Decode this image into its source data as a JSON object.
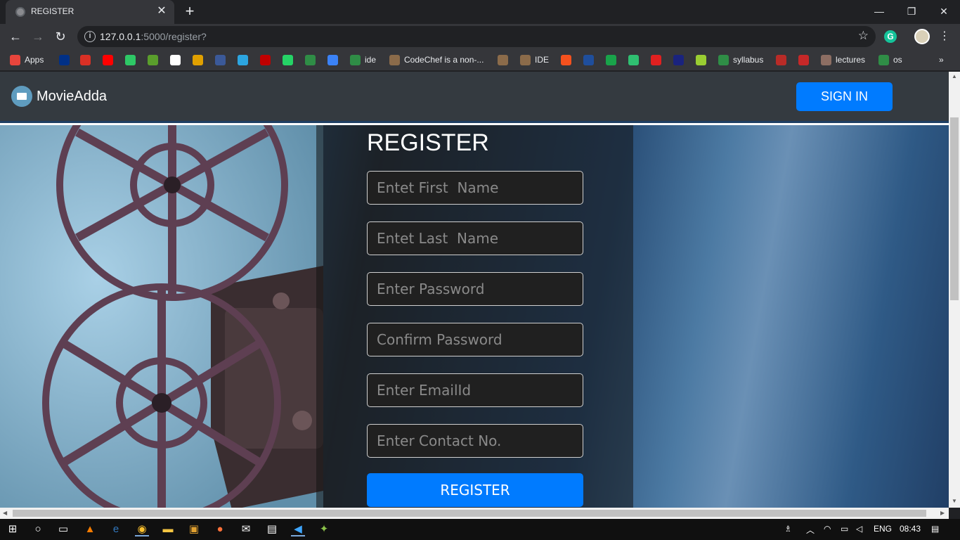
{
  "browser": {
    "tab_title": "REGISTER",
    "tab_close": "✕",
    "new_tab": "+",
    "window_controls": {
      "minimize": "—",
      "restore": "❐",
      "close": "✕"
    },
    "nav": {
      "back": "←",
      "forward": "→",
      "reload": "↻"
    },
    "url_host": "127.0.0.1",
    "url_rest": ":5000/register?",
    "info_icon": "i",
    "bookmark_star": "☆",
    "extension_letter": "G",
    "menu": "⋮",
    "bookmarks_overflow": "»"
  },
  "bookmarks": [
    {
      "label": "Apps",
      "icon": "apps-grid",
      "color": "#e8453c"
    },
    {
      "label": "",
      "icon": "paypal",
      "color": "#003087"
    },
    {
      "label": "",
      "icon": "gmail",
      "color": "#d93025"
    },
    {
      "label": "",
      "icon": "youtube",
      "color": "#ff0000"
    },
    {
      "label": "",
      "icon": "hackerrank",
      "color": "#2ec866"
    },
    {
      "label": "",
      "icon": "play",
      "color": "#5a9e2c"
    },
    {
      "label": "",
      "icon": "amazon",
      "color": "#ffffff"
    },
    {
      "label": "",
      "icon": "book",
      "color": "#e0a000"
    },
    {
      "label": "",
      "icon": "facebook",
      "color": "#3b5998"
    },
    {
      "label": "",
      "icon": "telegram",
      "color": "#2ca5e0"
    },
    {
      "label": "",
      "icon": "red-circle",
      "color": "#c00000"
    },
    {
      "label": "",
      "icon": "whatsapp",
      "color": "#25d366"
    },
    {
      "label": "",
      "icon": "geeks",
      "color": "#2f8d46"
    },
    {
      "label": "",
      "icon": "infinity",
      "color": "#3b82f6"
    },
    {
      "label": "ide",
      "icon": "geeks",
      "color": "#2f8d46"
    },
    {
      "label": "CodeChef is a non-...",
      "icon": "codechef",
      "color": "#8b6b4a"
    },
    {
      "label": "",
      "icon": "codechef",
      "color": "#8b6b4a"
    },
    {
      "label": "IDE",
      "icon": "codechef",
      "color": "#8b6b4a"
    },
    {
      "label": "",
      "icon": "g-square",
      "color": "#f4511e"
    },
    {
      "label": "",
      "icon": "pt",
      "color": "#1f4e9c"
    },
    {
      "label": "",
      "icon": "ftu",
      "color": "#19a34a"
    },
    {
      "label": "",
      "icon": "bird",
      "color": "#2fbf71"
    },
    {
      "label": "",
      "icon": "triangle",
      "color": "#e02020"
    },
    {
      "label": "",
      "icon": "r",
      "color": "#1a237e"
    },
    {
      "label": "",
      "icon": "diamond",
      "color": "#9acd32"
    },
    {
      "label": "syllabus",
      "icon": "geeks",
      "color": "#2f8d46"
    },
    {
      "label": "",
      "icon": "quora",
      "color": "#b92b27"
    },
    {
      "label": "",
      "icon": "question",
      "color": "#c62828"
    },
    {
      "label": "lectures",
      "icon": "picture",
      "color": "#8d6e63"
    },
    {
      "label": "os",
      "icon": "geeks",
      "color": "#2f8d46"
    }
  ],
  "navbar": {
    "brand": "MovieAdda",
    "sign_in": "SIGN IN"
  },
  "form": {
    "title": "REGISTER",
    "first_name_placeholder": "Entet First  Name",
    "last_name_placeholder": "Entet Last  Name",
    "password_placeholder": "Enter Password",
    "confirm_password_placeholder": "Confirm Password",
    "email_placeholder": "Enter EmailId",
    "contact_placeholder": "Enter Contact No.",
    "submit": "REGISTER"
  },
  "taskbar": {
    "language": "ENG",
    "time": "08:43"
  },
  "colors": {
    "accent": "#007bff",
    "navbar": "#343a40",
    "chrome_dark": "#202124",
    "chrome_toolbar": "#35363a"
  }
}
